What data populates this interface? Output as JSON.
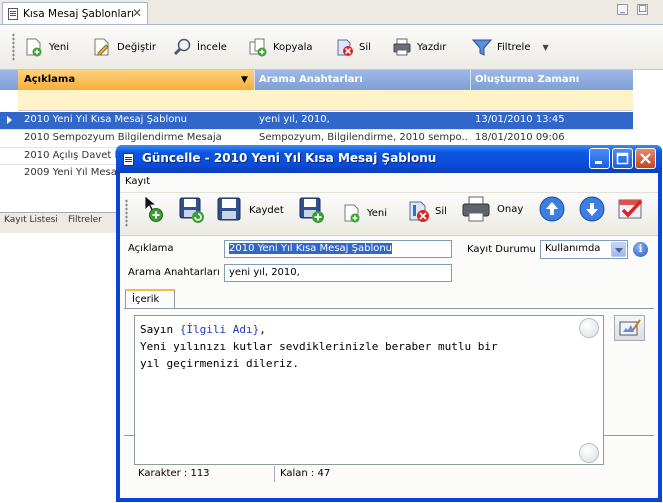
{
  "bg": {
    "tab_title": "Kısa Mesaj Şablonları",
    "tab_close": "✕",
    "toolbar": {
      "new": "Yeni",
      "edit": "Değiştir",
      "inspect": "İncele",
      "copy": "Kopyala",
      "delete": "Sil",
      "print": "Yazdır",
      "filter": "Filtrele"
    },
    "columns": [
      "Açıklama",
      "Arama Anahtarları",
      "Oluşturma Zamanı"
    ],
    "rows": [
      {
        "desc": "2010 Yeni Yıl Kısa Mesaj Şablonu",
        "keys": "yeni yıl, 2010,",
        "date": "13/01/2010 13:45",
        "selected": true
      },
      {
        "desc": "2010 Sempozyum Bilgilendirme Mesaja",
        "keys": "Sempozyum, Bilgilendirme, 2010 sempo...",
        "date": "18/01/2010 09:06"
      },
      {
        "desc": "2010 Açılış Davet Mesa",
        "keys": "",
        "date": ""
      },
      {
        "desc": "2009 Yeni Yıl Mesaj",
        "keys": "",
        "date": ""
      }
    ],
    "bottom_tabs": [
      "Kayıt Listesi",
      "Filtreler"
    ]
  },
  "dialog": {
    "title": "Güncelle - 2010 Yeni Yıl Kısa Mesaj Şablonu",
    "menu": "Kayıt",
    "toolbar": {
      "save": "Kaydet",
      "new": "Yeni",
      "delete": "Sil",
      "confirm": "Onay"
    },
    "fields": {
      "description_label": "Açıklama",
      "description_value": "2010 Yeni Yıl Kısa Mesaj Şablonu",
      "keywords_label": "Arama Anahtarları",
      "keywords_value": "yeni yıl, 2010,",
      "status_label": "Kayıt Durumu",
      "status_value": "Kullanımda",
      "info": "i"
    },
    "content_tab": "İçerik",
    "editor": {
      "greeting": "Sayın ",
      "placeholder": "{İlgili Adı}",
      "comma": ",",
      "line2": "Yeni yılınızı kutlar sevdiklerinizle beraber mutlu bir",
      "line3": "yıl geçirmenizi dileriz."
    },
    "status": {
      "chars": "Karakter : 113",
      "remaining": "Kalan : 47"
    }
  }
}
